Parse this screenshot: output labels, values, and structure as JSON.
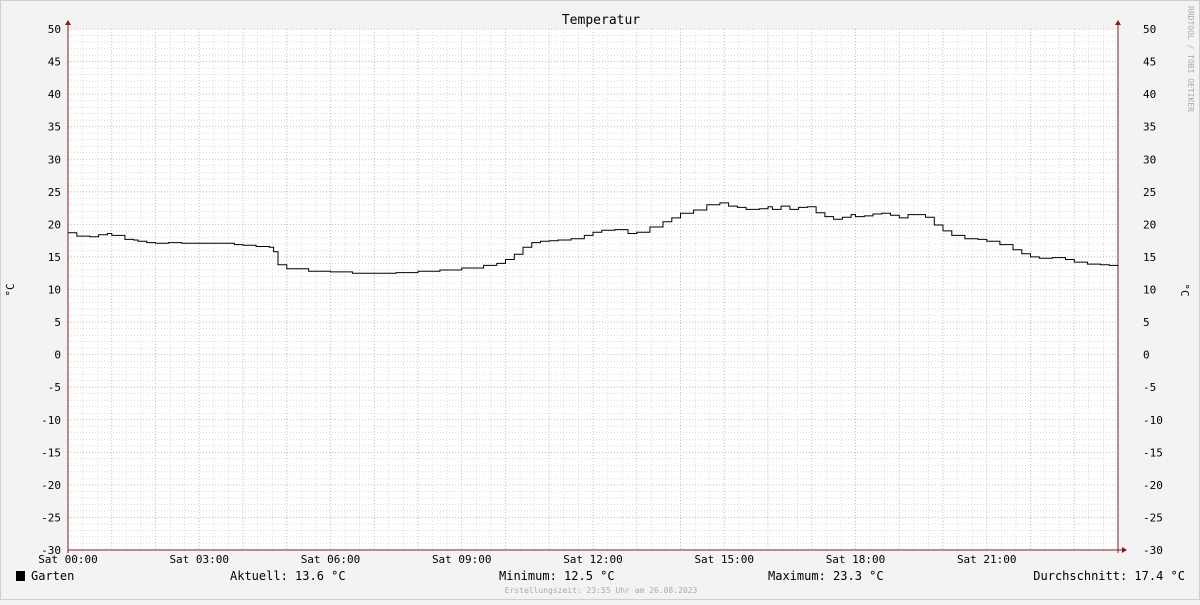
{
  "chart_data": {
    "type": "line",
    "title": "Temperatur",
    "ylabel": "°C",
    "ylabel_right": "°C",
    "ylim": [
      -30,
      50
    ],
    "yticks": [
      50,
      45,
      40,
      35,
      30,
      25,
      20,
      15,
      10,
      5,
      0,
      -5,
      -10,
      -15,
      -20,
      -25,
      -30
    ],
    "xlim": [
      0,
      24
    ],
    "xticks": [
      {
        "label": "Sat 00:00",
        "hour": 0
      },
      {
        "label": "Sat 03:00",
        "hour": 3
      },
      {
        "label": "Sat 06:00",
        "hour": 6
      },
      {
        "label": "Sat 09:00",
        "hour": 9
      },
      {
        "label": "Sat 12:00",
        "hour": 12
      },
      {
        "label": "Sat 15:00",
        "hour": 15
      },
      {
        "label": "Sat 18:00",
        "hour": 18
      },
      {
        "label": "Sat 21:00",
        "hour": 21
      }
    ],
    "grid": true,
    "series": [
      {
        "name": "Garten",
        "color": "#000000",
        "x": [
          0.0,
          0.2,
          0.5,
          0.7,
          0.9,
          1.0,
          1.3,
          1.5,
          1.6,
          1.8,
          2.0,
          2.3,
          2.6,
          3.0,
          3.3,
          3.6,
          3.8,
          4.0,
          4.3,
          4.6,
          4.7,
          4.8,
          5.0,
          5.5,
          6.0,
          6.5,
          7.0,
          7.5,
          8.0,
          8.5,
          9.0,
          9.5,
          9.8,
          10.0,
          10.2,
          10.4,
          10.6,
          10.8,
          11.0,
          11.2,
          11.5,
          11.8,
          12.0,
          12.2,
          12.5,
          12.8,
          13.0,
          13.3,
          13.6,
          13.8,
          14.0,
          14.3,
          14.6,
          14.9,
          15.1,
          15.3,
          15.5,
          15.8,
          16.0,
          16.1,
          16.3,
          16.5,
          16.7,
          16.9,
          17.1,
          17.3,
          17.5,
          17.7,
          17.9,
          18.0,
          18.2,
          18.4,
          18.6,
          18.8,
          19.0,
          19.2,
          19.4,
          19.6,
          19.8,
          20.0,
          20.2,
          20.5,
          20.8,
          21.0,
          21.3,
          21.6,
          21.8,
          22.0,
          22.2,
          22.5,
          22.8,
          23.0,
          23.3,
          23.6,
          23.8,
          24.0
        ],
        "values": [
          18.7,
          18.2,
          18.1,
          18.4,
          18.6,
          18.3,
          17.7,
          17.6,
          17.4,
          17.2,
          17.1,
          17.2,
          17.1,
          17.1,
          17.1,
          17.1,
          16.9,
          16.8,
          16.6,
          16.5,
          15.8,
          13.8,
          13.2,
          12.8,
          12.7,
          12.5,
          12.5,
          12.6,
          12.8,
          13.0,
          13.3,
          13.7,
          14.0,
          14.6,
          15.4,
          16.5,
          17.2,
          17.4,
          17.5,
          17.6,
          17.8,
          18.3,
          18.8,
          19.1,
          19.2,
          18.6,
          18.8,
          19.6,
          20.4,
          21.0,
          21.7,
          22.2,
          23.0,
          23.3,
          22.8,
          22.6,
          22.3,
          22.4,
          22.7,
          22.3,
          22.8,
          22.3,
          22.6,
          22.7,
          21.8,
          21.2,
          20.8,
          21.1,
          21.5,
          21.2,
          21.3,
          21.6,
          21.7,
          21.4,
          21.0,
          21.5,
          21.5,
          21.1,
          19.9,
          19.0,
          18.3,
          17.8,
          17.7,
          17.4,
          16.9,
          16.1,
          15.5,
          15.0,
          14.8,
          14.9,
          14.6,
          14.2,
          13.9,
          13.8,
          13.7,
          13.6
        ]
      }
    ]
  },
  "legend": {
    "series_name": "Garten",
    "current": "Aktuell: 13.6 °C",
    "minimum": "Minimum: 12.5 °C",
    "maximum": "Maximum: 23.3 °C",
    "average": "Durchschnitt: 17.4 °C"
  },
  "footer": {
    "created": "Erstellungszeit: 23:55 Uhr am 26.08.2023"
  },
  "watermark": "RRDTOOL / TOBI OETIKER",
  "colors": {
    "background": "#f3f3f3",
    "plot_background": "#ffffff",
    "minor_grid": "#c8c8c8",
    "major_grid": "#e6a0a0",
    "axis": "#8b1a1a",
    "line": "#000000"
  }
}
